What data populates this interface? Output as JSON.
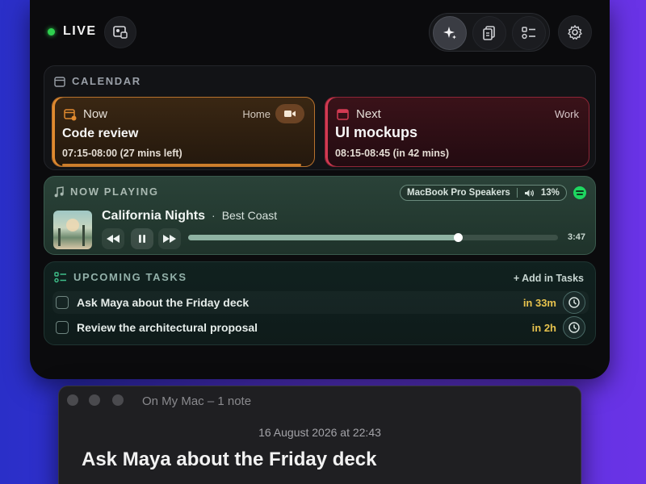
{
  "header": {
    "live_label": "LIVE",
    "icons": [
      "media-icon",
      "sparkle-icon",
      "clipboard-icon",
      "task-list-icon",
      "gear-icon"
    ]
  },
  "calendar": {
    "title": "CALENDAR",
    "events": [
      {
        "status": "Now",
        "tag": "Home",
        "title": "Code review",
        "time": "07:15-08:00 (27 mins left)",
        "color": "#e08a2f"
      },
      {
        "status": "Next",
        "tag": "Work",
        "title": "UI mockups",
        "time": "08:15-08:45 (in 42 mins)",
        "color": "#d23a52"
      }
    ]
  },
  "now_playing": {
    "title": "NOW PLAYING",
    "output_device": "MacBook Pro Speakers",
    "volume": "13%",
    "track": "California Nights",
    "separator": "·",
    "artist": "Best Coast",
    "duration": "3:47",
    "progress": 0.73,
    "accent": "#1ed760"
  },
  "tasks": {
    "title": "UPCOMING TASKS",
    "add_label": "+ Add in Tasks",
    "items": [
      {
        "text": "Ask Maya about the Friday deck",
        "due": "in 33m"
      },
      {
        "text": "Review the architectural proposal",
        "due": "in 2h"
      }
    ]
  },
  "notes": {
    "window_title": "On My Mac – 1 note",
    "date": "16 August 2026 at 22:43",
    "heading": "Ask Maya about the Friday deck"
  }
}
